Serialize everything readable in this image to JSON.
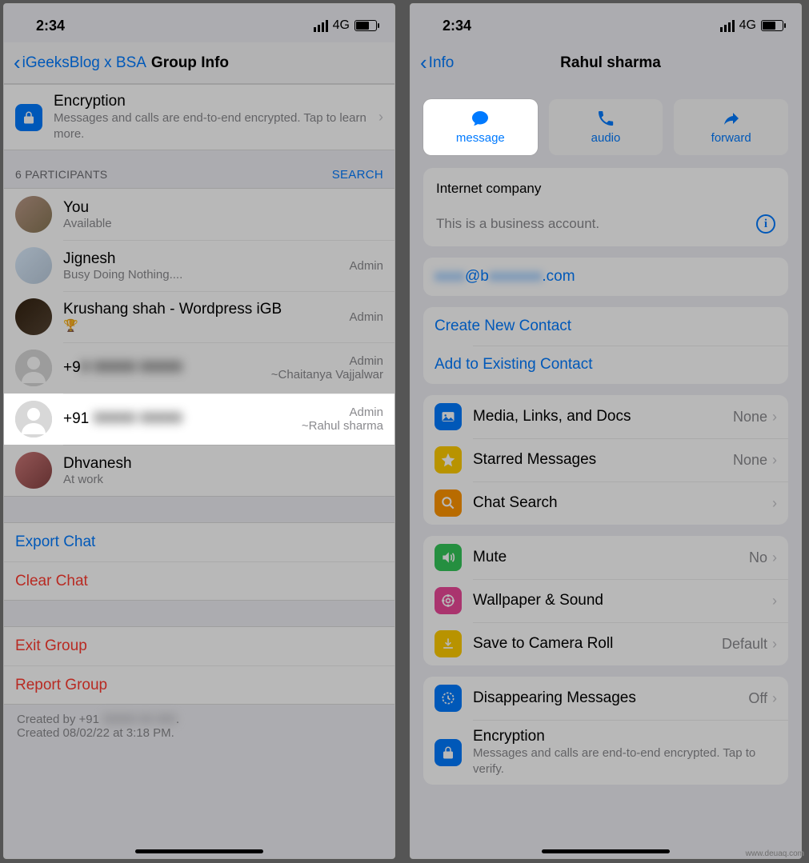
{
  "status": {
    "time": "2:34",
    "network": "4G"
  },
  "left": {
    "back_label": "iGeeksBlog x BSA",
    "title": "Group Info",
    "encryption": {
      "title": "Encryption",
      "subtitle": "Messages and calls are end-to-end encrypted. Tap to learn more."
    },
    "participants_header": "6 PARTICIPANTS",
    "search_label": "SEARCH",
    "participants": [
      {
        "name": "You",
        "status": "Available",
        "role": "",
        "alias": ""
      },
      {
        "name": "Jignesh",
        "status": "Busy Doing Nothing....",
        "role": "Admin",
        "alias": ""
      },
      {
        "name": "Krushang shah - Wordpress iGB",
        "status": "🏆",
        "role": "Admin",
        "alias": ""
      },
      {
        "name_prefix": "+9",
        "status": "",
        "role": "Admin",
        "alias": "~Chaitanya Vajjalwar"
      },
      {
        "name_prefix": "+91",
        "status": "",
        "role": "Admin",
        "alias": "~Rahul sharma"
      },
      {
        "name": "Dhvanesh",
        "status": "At work",
        "role": "",
        "alias": ""
      }
    ],
    "actions": {
      "export": "Export Chat",
      "clear": "Clear Chat",
      "exit": "Exit Group",
      "report": "Report Group"
    },
    "footer_line1_prefix": "Created by +91 ",
    "footer_line1_suffix": ".",
    "footer_line2": "Created 08/02/22 at 3:18 PM."
  },
  "right": {
    "back_label": "Info",
    "title": "Rahul sharma",
    "actions": {
      "message": "message",
      "audio": "audio",
      "forward": "forward"
    },
    "business": {
      "type": "Internet company",
      "note": "This is a business account."
    },
    "email_prefix": "",
    "email_mid": "@b",
    "email_suffix": ".com",
    "contact_actions": {
      "create": "Create New Contact",
      "add": "Add to Existing Contact"
    },
    "rows": {
      "media": {
        "label": "Media, Links, and Docs",
        "value": "None"
      },
      "starred": {
        "label": "Starred Messages",
        "value": "None"
      },
      "search": {
        "label": "Chat Search",
        "value": ""
      },
      "mute": {
        "label": "Mute",
        "value": "No"
      },
      "wallpaper": {
        "label": "Wallpaper & Sound",
        "value": ""
      },
      "camera": {
        "label": "Save to Camera Roll",
        "value": "Default"
      },
      "disappearing": {
        "label": "Disappearing Messages",
        "value": "Off"
      },
      "encryption": {
        "label": "Encryption",
        "sub": "Messages and calls are end-to-end encrypted. Tap to verify."
      }
    }
  },
  "watermark": "www.deuaq.com"
}
